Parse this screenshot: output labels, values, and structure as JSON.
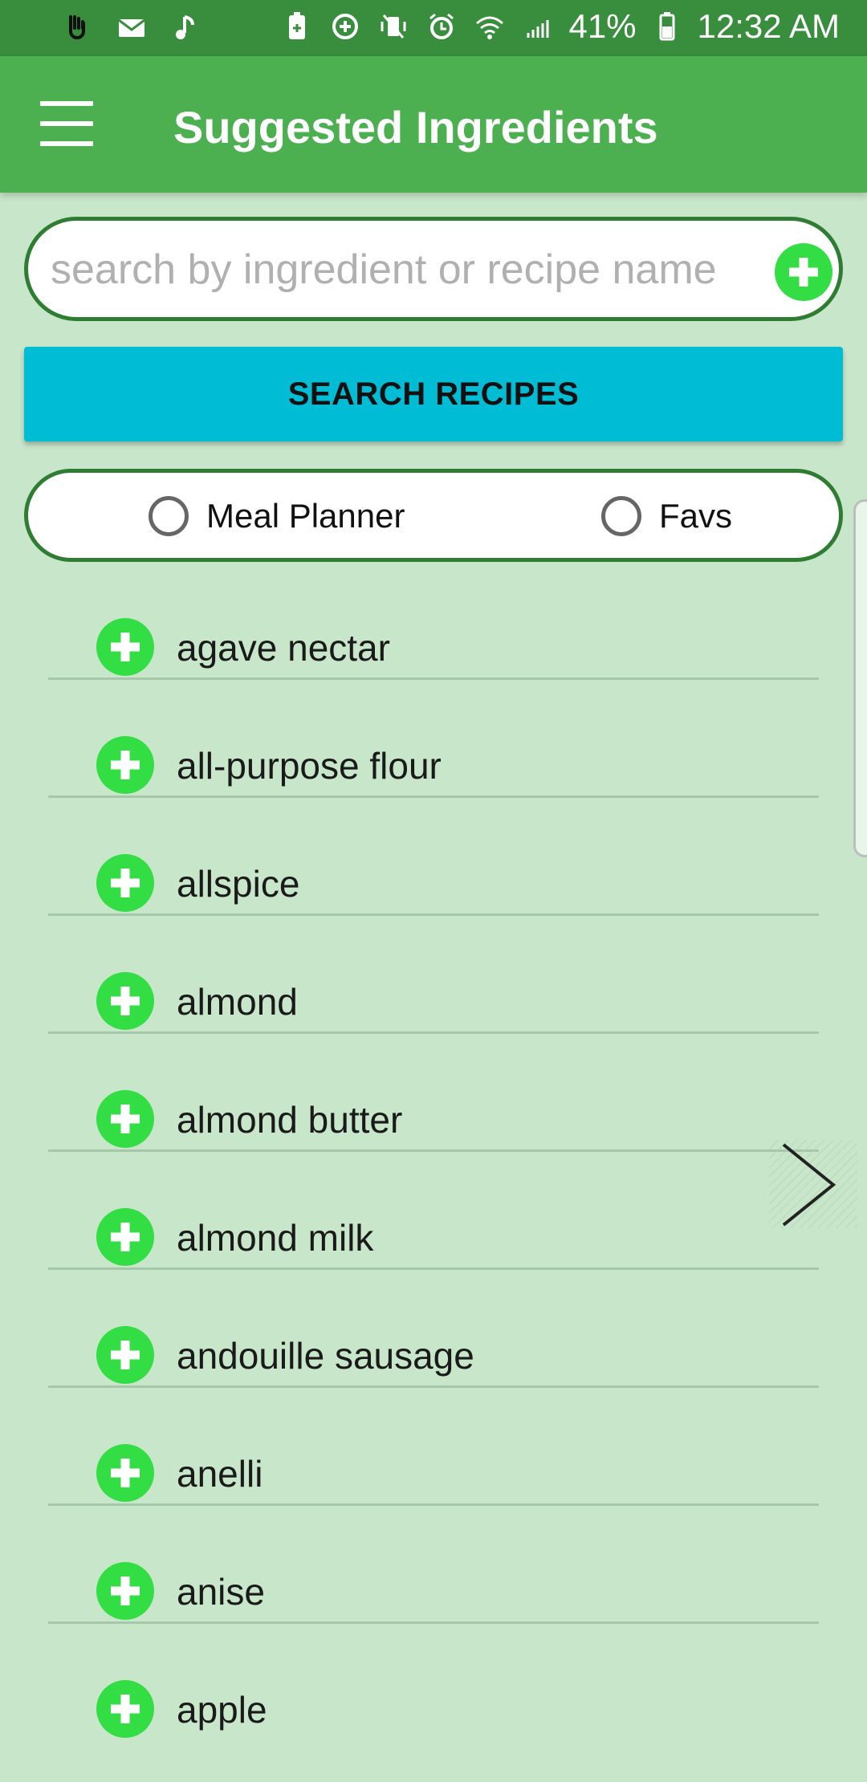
{
  "status_bar": {
    "battery_percent": "41%",
    "time": "12:32 AM",
    "icons": [
      "hand-icon",
      "mail-icon",
      "music-icon",
      "battery-saver-icon",
      "sync-icon",
      "vibrate-icon",
      "alarm-icon",
      "wifi-icon",
      "signal-icon",
      "battery-icon"
    ]
  },
  "app_bar": {
    "title": "Suggested Ingredients",
    "menu_icon": "hamburger-menu-icon"
  },
  "search": {
    "placeholder": "search by ingredient or recipe name",
    "value": "",
    "add_icon": "plus-circle-icon"
  },
  "search_button": {
    "label": "SEARCH RECIPES"
  },
  "filters": {
    "options": [
      {
        "label": "Meal Planner",
        "selected": false
      },
      {
        "label": "Favs",
        "selected": false
      }
    ]
  },
  "ingredients": [
    "agave nectar",
    "all-purpose flour",
    "allspice",
    "almond",
    "almond butter",
    "almond milk",
    "andouille sausage",
    "anelli",
    "anise",
    "apple"
  ],
  "colors": {
    "status_bar": "#388e3c",
    "app_bar": "#4caf50",
    "background": "#c8e6c9",
    "accent_plus": "#33dd44",
    "search_button": "#00bcd4",
    "border": "#2e7d32"
  }
}
